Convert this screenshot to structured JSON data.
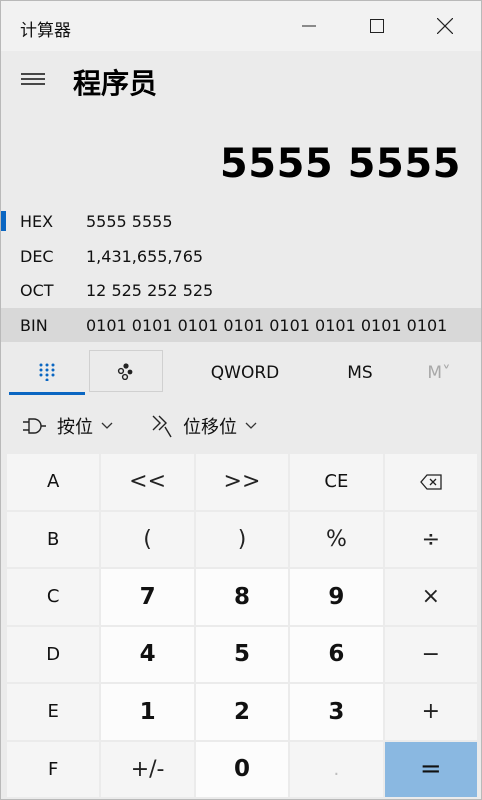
{
  "window": {
    "title": "计算器"
  },
  "header": {
    "mode": "程序员"
  },
  "display": {
    "value": "5555 5555"
  },
  "radix": [
    {
      "label": "HEX",
      "value": "5555 5555"
    },
    {
      "label": "DEC",
      "value": "1,431,655,765"
    },
    {
      "label": "OCT",
      "value": "12 525 252 525"
    },
    {
      "label": "BIN",
      "value": "0101 0101 0101 0101 0101 0101 0101 0101"
    }
  ],
  "toolbar": {
    "word_size": "QWORD",
    "ms": "MS",
    "m": "M˅"
  },
  "dropdowns": {
    "bitwise": "按位",
    "shift": "位移位"
  },
  "keys": [
    [
      "A",
      "<<",
      ">>",
      "CE",
      "⌫"
    ],
    [
      "B",
      "(",
      ")",
      "%",
      "÷"
    ],
    [
      "C",
      "7",
      "8",
      "9",
      "×"
    ],
    [
      "D",
      "4",
      "5",
      "6",
      "−"
    ],
    [
      "E",
      "1",
      "2",
      "3",
      "+"
    ],
    [
      "F",
      "+/-",
      "0",
      ".",
      "="
    ]
  ],
  "colors": {
    "accent": "#0a66c2",
    "equals_bg": "#8ab8e1"
  }
}
